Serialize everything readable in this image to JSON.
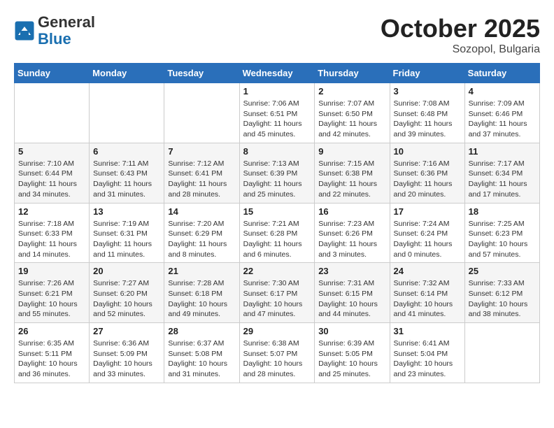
{
  "header": {
    "logo": {
      "general": "General",
      "blue": "Blue"
    },
    "title": "October 2025",
    "subtitle": "Sozopol, Bulgaria"
  },
  "weekdays": [
    "Sunday",
    "Monday",
    "Tuesday",
    "Wednesday",
    "Thursday",
    "Friday",
    "Saturday"
  ],
  "weeks": [
    [
      {
        "day": "",
        "info": ""
      },
      {
        "day": "",
        "info": ""
      },
      {
        "day": "",
        "info": ""
      },
      {
        "day": "1",
        "info": "Sunrise: 7:06 AM\nSunset: 6:51 PM\nDaylight: 11 hours\nand 45 minutes."
      },
      {
        "day": "2",
        "info": "Sunrise: 7:07 AM\nSunset: 6:50 PM\nDaylight: 11 hours\nand 42 minutes."
      },
      {
        "day": "3",
        "info": "Sunrise: 7:08 AM\nSunset: 6:48 PM\nDaylight: 11 hours\nand 39 minutes."
      },
      {
        "day": "4",
        "info": "Sunrise: 7:09 AM\nSunset: 6:46 PM\nDaylight: 11 hours\nand 37 minutes."
      }
    ],
    [
      {
        "day": "5",
        "info": "Sunrise: 7:10 AM\nSunset: 6:44 PM\nDaylight: 11 hours\nand 34 minutes."
      },
      {
        "day": "6",
        "info": "Sunrise: 7:11 AM\nSunset: 6:43 PM\nDaylight: 11 hours\nand 31 minutes."
      },
      {
        "day": "7",
        "info": "Sunrise: 7:12 AM\nSunset: 6:41 PM\nDaylight: 11 hours\nand 28 minutes."
      },
      {
        "day": "8",
        "info": "Sunrise: 7:13 AM\nSunset: 6:39 PM\nDaylight: 11 hours\nand 25 minutes."
      },
      {
        "day": "9",
        "info": "Sunrise: 7:15 AM\nSunset: 6:38 PM\nDaylight: 11 hours\nand 22 minutes."
      },
      {
        "day": "10",
        "info": "Sunrise: 7:16 AM\nSunset: 6:36 PM\nDaylight: 11 hours\nand 20 minutes."
      },
      {
        "day": "11",
        "info": "Sunrise: 7:17 AM\nSunset: 6:34 PM\nDaylight: 11 hours\nand 17 minutes."
      }
    ],
    [
      {
        "day": "12",
        "info": "Sunrise: 7:18 AM\nSunset: 6:33 PM\nDaylight: 11 hours\nand 14 minutes."
      },
      {
        "day": "13",
        "info": "Sunrise: 7:19 AM\nSunset: 6:31 PM\nDaylight: 11 hours\nand 11 minutes."
      },
      {
        "day": "14",
        "info": "Sunrise: 7:20 AM\nSunset: 6:29 PM\nDaylight: 11 hours\nand 8 minutes."
      },
      {
        "day": "15",
        "info": "Sunrise: 7:21 AM\nSunset: 6:28 PM\nDaylight: 11 hours\nand 6 minutes."
      },
      {
        "day": "16",
        "info": "Sunrise: 7:23 AM\nSunset: 6:26 PM\nDaylight: 11 hours\nand 3 minutes."
      },
      {
        "day": "17",
        "info": "Sunrise: 7:24 AM\nSunset: 6:24 PM\nDaylight: 11 hours\nand 0 minutes."
      },
      {
        "day": "18",
        "info": "Sunrise: 7:25 AM\nSunset: 6:23 PM\nDaylight: 10 hours\nand 57 minutes."
      }
    ],
    [
      {
        "day": "19",
        "info": "Sunrise: 7:26 AM\nSunset: 6:21 PM\nDaylight: 10 hours\nand 55 minutes."
      },
      {
        "day": "20",
        "info": "Sunrise: 7:27 AM\nSunset: 6:20 PM\nDaylight: 10 hours\nand 52 minutes."
      },
      {
        "day": "21",
        "info": "Sunrise: 7:28 AM\nSunset: 6:18 PM\nDaylight: 10 hours\nand 49 minutes."
      },
      {
        "day": "22",
        "info": "Sunrise: 7:30 AM\nSunset: 6:17 PM\nDaylight: 10 hours\nand 47 minutes."
      },
      {
        "day": "23",
        "info": "Sunrise: 7:31 AM\nSunset: 6:15 PM\nDaylight: 10 hours\nand 44 minutes."
      },
      {
        "day": "24",
        "info": "Sunrise: 7:32 AM\nSunset: 6:14 PM\nDaylight: 10 hours\nand 41 minutes."
      },
      {
        "day": "25",
        "info": "Sunrise: 7:33 AM\nSunset: 6:12 PM\nDaylight: 10 hours\nand 38 minutes."
      }
    ],
    [
      {
        "day": "26",
        "info": "Sunrise: 6:35 AM\nSunset: 5:11 PM\nDaylight: 10 hours\nand 36 minutes."
      },
      {
        "day": "27",
        "info": "Sunrise: 6:36 AM\nSunset: 5:09 PM\nDaylight: 10 hours\nand 33 minutes."
      },
      {
        "day": "28",
        "info": "Sunrise: 6:37 AM\nSunset: 5:08 PM\nDaylight: 10 hours\nand 31 minutes."
      },
      {
        "day": "29",
        "info": "Sunrise: 6:38 AM\nSunset: 5:07 PM\nDaylight: 10 hours\nand 28 minutes."
      },
      {
        "day": "30",
        "info": "Sunrise: 6:39 AM\nSunset: 5:05 PM\nDaylight: 10 hours\nand 25 minutes."
      },
      {
        "day": "31",
        "info": "Sunrise: 6:41 AM\nSunset: 5:04 PM\nDaylight: 10 hours\nand 23 minutes."
      },
      {
        "day": "",
        "info": ""
      }
    ]
  ]
}
